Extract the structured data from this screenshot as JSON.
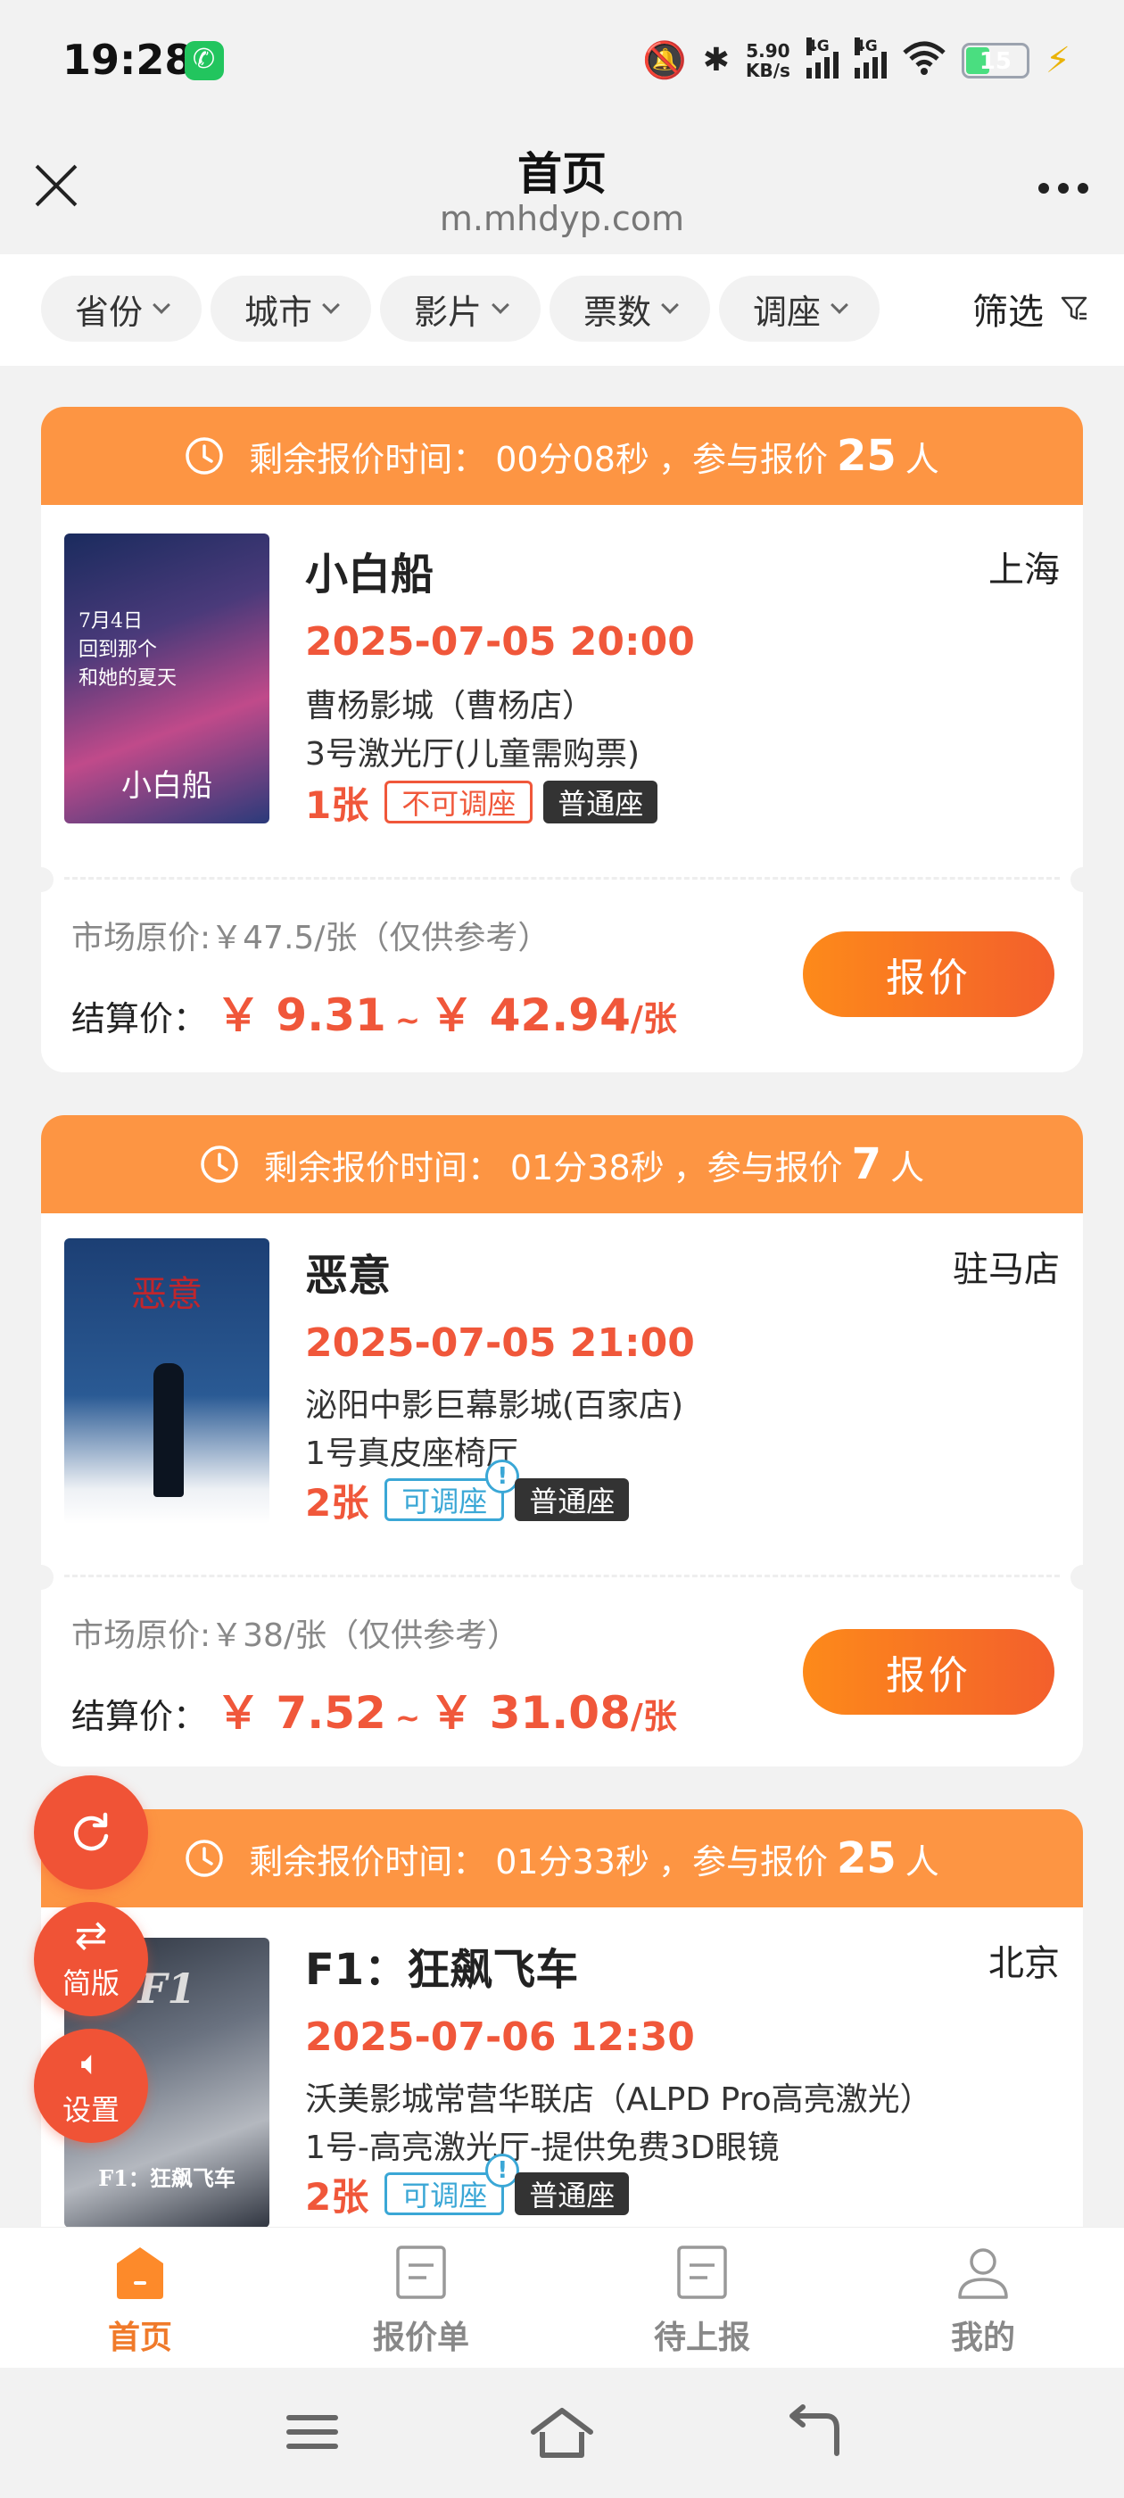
{
  "status_bar": {
    "time": "19:28",
    "net_speed_value": "5.90",
    "net_speed_unit": "KB/s",
    "signal1_label": "4G",
    "signal2_label": "4G",
    "battery": "15",
    "icons": [
      "call-app-icon",
      "mute-icon",
      "bluetooth-icon",
      "signal-icon",
      "wifi-icon",
      "battery-icon",
      "charging-icon"
    ]
  },
  "header": {
    "title": "首页",
    "subtitle": "m.mhdyp.com"
  },
  "filters": {
    "chips": [
      "省份",
      "城市",
      "影片",
      "票数",
      "调座"
    ],
    "filter_label": "筛选"
  },
  "cards": [
    {
      "countdown_prefix": "剩余报价时间：",
      "countdown": "00分08秒",
      "bidders_prefix": "，参与报价",
      "bidders": "25",
      "bidders_suffix": "人",
      "title": "小白船",
      "city": "上海",
      "datetime": "2025-07-05 20:00",
      "cinema": "曹杨影城（曹杨店）",
      "hall": "3号激光厅(儿童需购票)",
      "tickets": "1张",
      "seat_adjust": "不可调座",
      "seat_type": "普通座",
      "market_price": "市场原价:￥47.5/张（仅供参考）",
      "settle_label": "结算价：",
      "price_low": "￥ 9.31",
      "price_sep": "~",
      "price_high": "￥ 42.94",
      "price_unit": "/张",
      "quote_button": "报价",
      "poster_text": "小白船"
    },
    {
      "countdown_prefix": "剩余报价时间：",
      "countdown": "01分38秒",
      "bidders_prefix": "，参与报价",
      "bidders": "7",
      "bidders_suffix": "人",
      "title": "恶意",
      "city": "驻马店",
      "datetime": "2025-07-05 21:00",
      "cinema": "泌阳中影巨幕影城(百家店)",
      "hall": "1号真皮座椅厅",
      "tickets": "2张",
      "seat_adjust": "可调座",
      "seat_type": "普通座",
      "market_price": "市场原价:￥38/张（仅供参考）",
      "settle_label": "结算价：",
      "price_low": "￥ 7.52",
      "price_sep": "~",
      "price_high": "￥ 31.08",
      "price_unit": "/张",
      "quote_button": "报价",
      "poster_text": "恶意"
    },
    {
      "countdown_prefix": "剩余报价时间：",
      "countdown": "01分33秒",
      "bidders_prefix": "，参与报价",
      "bidders": "25",
      "bidders_suffix": "人",
      "title": "F1：狂飙飞车",
      "city": "北京",
      "datetime": "2025-07-06 12:30",
      "cinema": "沃美影城常营华联店（ALPD Pro高亮激光）",
      "hall": "1号-高亮激光厅-提供免费3D眼镜",
      "tickets": "2张",
      "seat_adjust": "可调座",
      "seat_type": "普通座",
      "poster_text": "F1：狂飙飞车"
    }
  ],
  "floating": {
    "refresh_icon": "refresh-icon",
    "simple_label": "简版",
    "settings_label": "设置"
  },
  "bottom_nav": {
    "items": [
      {
        "label": "首页",
        "icon": "home-icon",
        "active": true
      },
      {
        "label": "报价单",
        "icon": "document-icon",
        "active": false
      },
      {
        "label": "待上报",
        "icon": "document-icon",
        "active": false
      },
      {
        "label": "我的",
        "icon": "user-icon",
        "active": false
      }
    ]
  },
  "colors": {
    "accent_orange": "#fd9543",
    "price_red": "#f0573a",
    "tag_blue": "#3aa7d6",
    "fab_red": "#f05336"
  }
}
